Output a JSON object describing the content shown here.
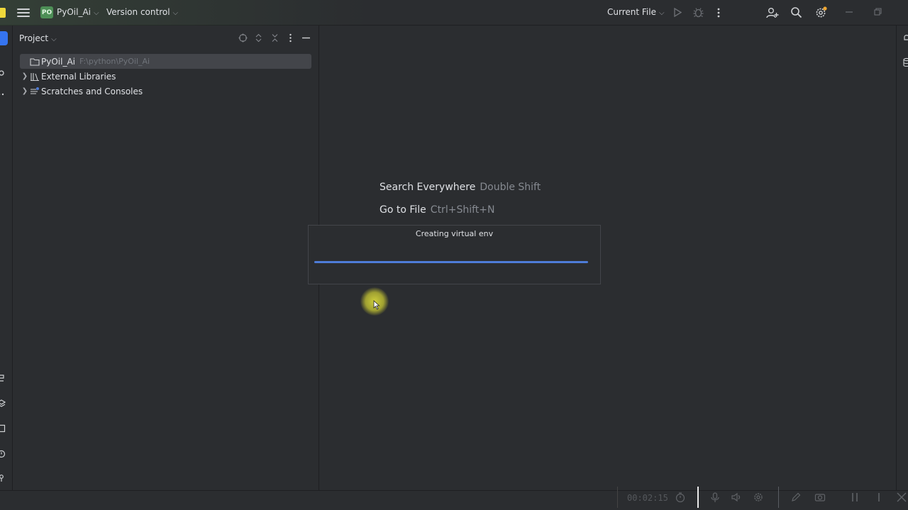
{
  "titlebar": {
    "project_badge": "PO",
    "project_name": "PyOil_Ai",
    "vcs_label": "Version control",
    "run_config": "Current File"
  },
  "project_panel": {
    "title": "Project",
    "tree": [
      {
        "label": "PyOil_Ai",
        "path": "F:\\python\\PyOil_Ai",
        "selected": true
      },
      {
        "label": "External Libraries"
      },
      {
        "label": "Scratches and Consoles"
      }
    ]
  },
  "editor": {
    "hints": [
      {
        "action": "Search Everywhere",
        "shortcut": "Double Shift"
      },
      {
        "action": "Go to File",
        "shortcut": "Ctrl+Shift+N"
      }
    ]
  },
  "progress": {
    "title": "Creating virtual env",
    "value": 1.0
  },
  "recorder": {
    "time": "00:02:15"
  },
  "colors": {
    "accent": "#3574f0",
    "progress": "#4e7cd8",
    "project_badge": "#4d8f56"
  }
}
